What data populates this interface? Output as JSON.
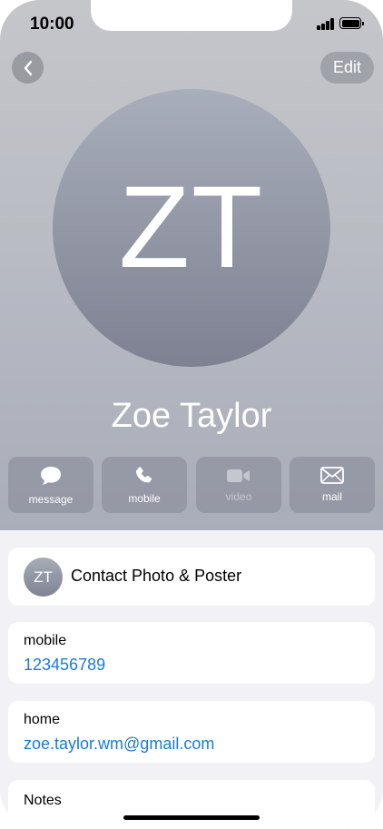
{
  "status_bar": {
    "time": "10:00"
  },
  "nav": {
    "edit_label": "Edit"
  },
  "contact": {
    "initials": "ZT",
    "name": "Zoe Taylor"
  },
  "actions": [
    {
      "label": "message",
      "icon": "message-bubble-icon",
      "enabled": true
    },
    {
      "label": "mobile",
      "icon": "phone-icon",
      "enabled": true
    },
    {
      "label": "video",
      "icon": "video-camera-icon",
      "enabled": false
    },
    {
      "label": "mail",
      "icon": "envelope-icon",
      "enabled": true
    }
  ],
  "photo_poster": {
    "initials": "ZT",
    "label": "Contact Photo & Poster"
  },
  "fields": [
    {
      "label": "mobile",
      "value": "123456789"
    },
    {
      "label": "home",
      "value": "zoe.taylor.wm@gmail.com"
    }
  ],
  "notes": {
    "label": "Notes"
  },
  "colors": {
    "link": "#1a7ad9",
    "hero_top": "#c5c6ca",
    "hero_bottom": "#a9adb9"
  }
}
